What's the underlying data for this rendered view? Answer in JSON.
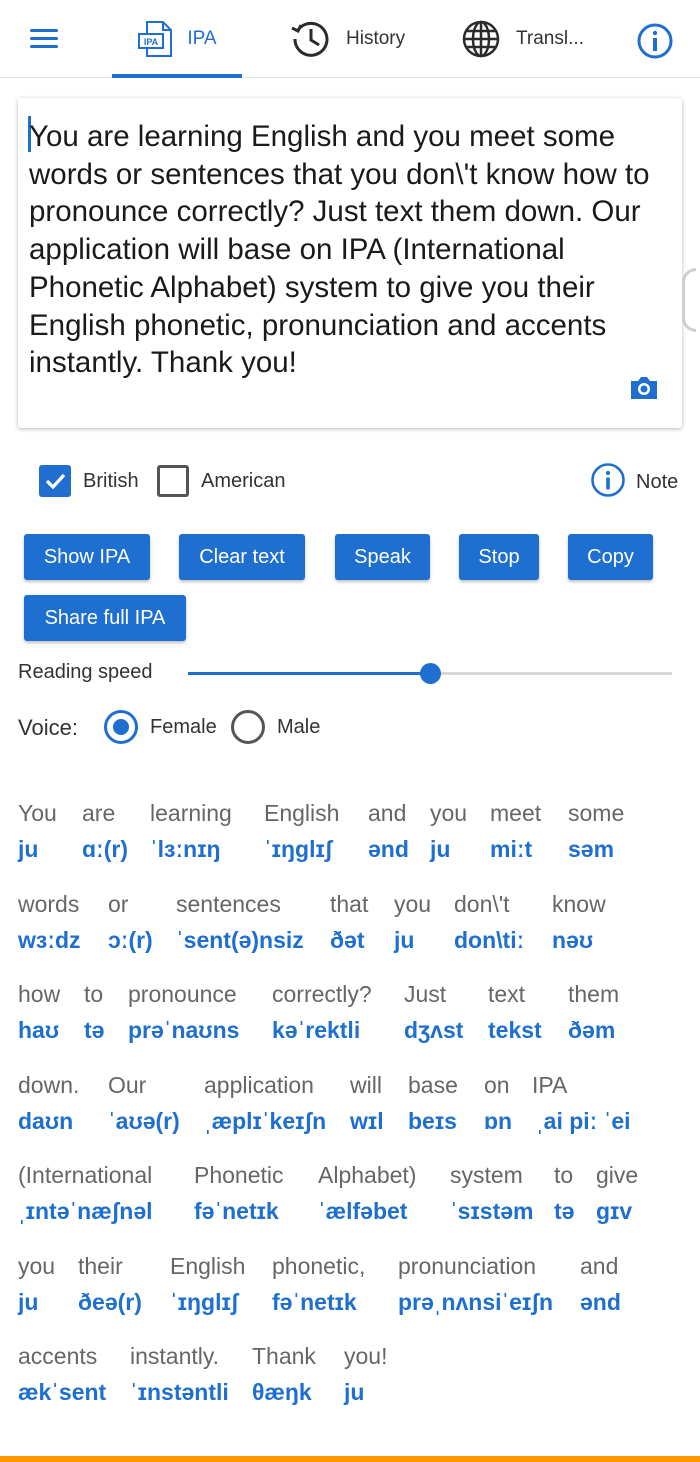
{
  "tabs": {
    "ipa": "IPA",
    "history": "History",
    "translate": "Transl..."
  },
  "ipa_icon_text": "IPA",
  "input": {
    "text": "You are learning English and you meet some words or sentences that you don\\'t know how to pronounce correctly? Just text them down. Our application will base on IPA (International Phonetic Alphabet) system to give you their English phonetic, pronunciation and accents instantly. Thank you!"
  },
  "options": {
    "british": "British",
    "american": "American",
    "note": "Note",
    "british_checked": true,
    "american_checked": false
  },
  "buttons": {
    "show_ipa": "Show IPA",
    "clear_text": "Clear text",
    "speak": "Speak",
    "stop": "Stop",
    "copy": "Copy",
    "share": "Share full IPA"
  },
  "speed": {
    "label": "Reading speed",
    "value": 0.5
  },
  "voice": {
    "label": "Voice:",
    "female": "Female",
    "male": "Male",
    "selected": "Female"
  },
  "colors": {
    "accent": "#1e6fd0",
    "bottom_bar": "#ff9800"
  },
  "results": [
    [
      {
        "w": "You",
        "p": "ju"
      },
      {
        "w": "are",
        "p": "ɑː(r)"
      },
      {
        "w": "learning",
        "p": "ˈlɜːnɪŋ"
      },
      {
        "w": "English",
        "p": "ˈɪŋglɪʃ"
      },
      {
        "w": "and",
        "p": "ənd"
      },
      {
        "w": "you",
        "p": "ju"
      },
      {
        "w": "meet",
        "p": "miːt"
      },
      {
        "w": "some",
        "p": "səm"
      }
    ],
    [
      {
        "w": "words",
        "p": "wɜːdz"
      },
      {
        "w": "or",
        "p": "ɔː(r)"
      },
      {
        "w": "sentences",
        "p": "ˈsent(ə)nsiz"
      },
      {
        "w": "that",
        "p": "ðət"
      },
      {
        "w": "you",
        "p": "ju"
      },
      {
        "w": "don\\'t",
        "p": "don\\tiː"
      },
      {
        "w": "know",
        "p": "nəʊ"
      }
    ],
    [
      {
        "w": "how",
        "p": "haʊ"
      },
      {
        "w": "to",
        "p": "tə"
      },
      {
        "w": "pronounce",
        "p": "prəˈnaʊns"
      },
      {
        "w": "correctly?",
        "p": "kəˈrektli"
      },
      {
        "w": "Just",
        "p": "dʒʌst"
      },
      {
        "w": "text",
        "p": "tekst"
      },
      {
        "w": "them",
        "p": "ðəm"
      }
    ],
    [
      {
        "w": "down.",
        "p": "daʊn"
      },
      {
        "w": "Our",
        "p": "ˈaʊə(r)"
      },
      {
        "w": "application",
        "p": "ˌæplɪˈkeɪʃn"
      },
      {
        "w": "will",
        "p": "wɪl"
      },
      {
        "w": "base",
        "p": "beɪs"
      },
      {
        "w": "on",
        "p": "ɒn"
      },
      {
        "w": "IPA",
        "p": "ˌai piː ˈei"
      }
    ],
    [
      {
        "w": "(International",
        "p": "ˌɪntəˈnæʃnəl"
      },
      {
        "w": "Phonetic",
        "p": "fəˈnetɪk"
      },
      {
        "w": "Alphabet)",
        "p": "ˈælfəbet"
      },
      {
        "w": "system",
        "p": "ˈsɪstəm"
      },
      {
        "w": "to",
        "p": "tə"
      },
      {
        "w": "give",
        "p": "gɪv"
      }
    ],
    [
      {
        "w": "you",
        "p": "ju"
      },
      {
        "w": "their",
        "p": "ðeə(r)"
      },
      {
        "w": "English",
        "p": "ˈɪŋglɪʃ"
      },
      {
        "w": "phonetic,",
        "p": "fəˈnetɪk"
      },
      {
        "w": "pronunciation",
        "p": "prəˌnʌnsiˈeɪʃn"
      },
      {
        "w": "and",
        "p": "ənd"
      }
    ],
    [
      {
        "w": "accents",
        "p": "ækˈsent"
      },
      {
        "w": "instantly.",
        "p": "ˈɪnstəntli"
      },
      {
        "w": "Thank",
        "p": "θæŋk"
      },
      {
        "w": "you!",
        "p": "ju"
      }
    ]
  ]
}
